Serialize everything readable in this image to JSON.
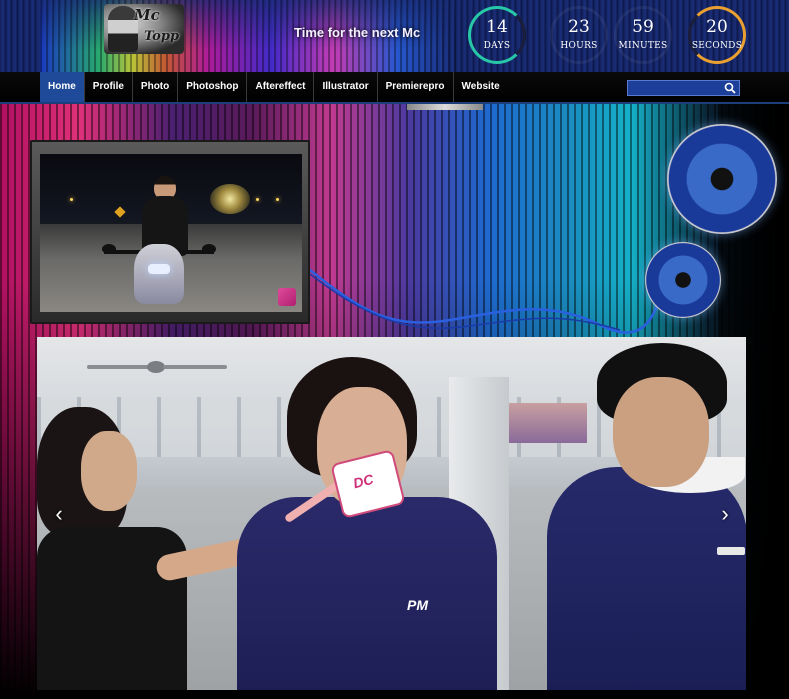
{
  "header": {
    "logo_text_1": "Mc",
    "logo_text_2": "Topp",
    "tagline": "Time for the next Mc",
    "countdown": {
      "days": {
        "value": "14",
        "label": "DAYS"
      },
      "hours": {
        "value": "23",
        "label": "HOURS"
      },
      "minutes": {
        "value": "59",
        "label": "MINUTES"
      },
      "seconds": {
        "value": "20",
        "label": "SECONDS"
      }
    },
    "colors": {
      "days_ring": "#27c7a8",
      "seconds_ring": "#e9a030"
    }
  },
  "nav": {
    "items": [
      {
        "label": "Home",
        "active": true
      },
      {
        "label": "Profile"
      },
      {
        "label": "Photo"
      },
      {
        "label": "Photoshop"
      },
      {
        "label": "Aftereffect"
      },
      {
        "label": "Illustrator"
      },
      {
        "label": "Premierepro"
      },
      {
        "label": "Website"
      }
    ],
    "search": {
      "value": "",
      "icon": "search-icon"
    },
    "active_color": "#1f4a9a"
  },
  "video": {
    "icon": "video-logo-icon"
  },
  "slider": {
    "mic_flag_text": "DC",
    "shirt_emblem": "PM",
    "prev_icon": "chevron-left-icon",
    "next_icon": "chevron-right-icon",
    "prev_glyph": "‹",
    "next_glyph": "›"
  }
}
